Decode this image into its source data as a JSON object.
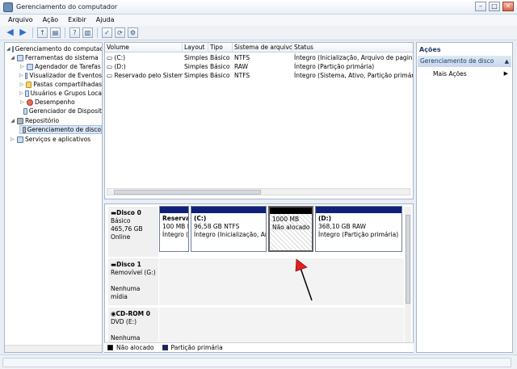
{
  "window": {
    "title": "Gerenciamento do computador"
  },
  "menu": [
    "Arquivo",
    "Ação",
    "Exibir",
    "Ajuda"
  ],
  "tree": [
    {
      "label": "Gerenciamento do computado",
      "icon": "computer-icon",
      "level": 0,
      "expanded": "open"
    },
    {
      "label": "Ferramentas do sistema",
      "icon": "tools-icon",
      "level": 1,
      "expanded": "open"
    },
    {
      "label": "Agendador de Tarefas",
      "icon": "clock-icon",
      "level": 2,
      "expanded": "closed"
    },
    {
      "label": "Visualizador de Eventos",
      "icon": "event-viewer-icon",
      "level": 2,
      "expanded": "closed"
    },
    {
      "label": "Pastas compartilhadas",
      "icon": "shared-folder-icon",
      "level": 2,
      "expanded": "closed"
    },
    {
      "label": "Usuários e Grupos Loca",
      "icon": "users-icon",
      "level": 2,
      "expanded": "closed"
    },
    {
      "label": "Desempenho",
      "icon": "performance-icon",
      "level": 2,
      "expanded": "closed"
    },
    {
      "label": "Gerenciador de Disposit",
      "icon": "device-manager-icon",
      "level": 2,
      "expanded": "none"
    },
    {
      "label": "Repositório",
      "icon": "storage-icon",
      "level": 1,
      "expanded": "open"
    },
    {
      "label": "Gerenciamento de disco",
      "icon": "disk-management-icon",
      "level": 2,
      "expanded": "none",
      "selected": true
    },
    {
      "label": "Serviços e aplicativos",
      "icon": "services-icon",
      "level": 1,
      "expanded": "closed"
    }
  ],
  "volumes": {
    "columns": [
      "Volume",
      "Layout",
      "Tipo",
      "Sistema de arquivos",
      "Status"
    ],
    "rows": [
      [
        "(C:)",
        "Simples",
        "Básico",
        "NTFS",
        "Íntegro (Inicialização, Arquivo de paginaçã"
      ],
      [
        "(D:)",
        "Simples",
        "Básico",
        "RAW",
        "Íntegro (Partição primária)"
      ],
      [
        "Reservado pelo Sistema",
        "Simples",
        "Básico",
        "NTFS",
        "Íntegro (Sistema, Ativo, Partição primária)"
      ]
    ]
  },
  "disks": [
    {
      "name": "Disco 0",
      "lines": [
        "Básico",
        "465,76 GB",
        "Online"
      ]
    },
    {
      "name": "Disco 1",
      "lines": [
        "Removível (G:)",
        "",
        "Nenhuma mídia"
      ]
    },
    {
      "name": "CD-ROM 0",
      "lines": [
        "DVD (E:)",
        "",
        "Nenhuma mídia"
      ]
    }
  ],
  "partitions": [
    {
      "title": "Reserva",
      "size": "100 MB I",
      "status": "Íntegro ("
    },
    {
      "title": "(C:)",
      "size": "96,58 GB NTFS",
      "status": "Íntegro (Inicialização, Arq"
    },
    {
      "title": "",
      "size": "1000 MB",
      "status": "Não alocado"
    },
    {
      "title": "(D:)",
      "size": "368,10 GB RAW",
      "status": "Íntegro (Partição primária)"
    }
  ],
  "legend": [
    {
      "label": "Não alocado",
      "color": "#000000"
    },
    {
      "label": "Partição primária",
      "color": "#10207a"
    }
  ],
  "actions": {
    "title": "Ações",
    "section": "Gerenciamento de disco",
    "more": "Mais Ações"
  }
}
